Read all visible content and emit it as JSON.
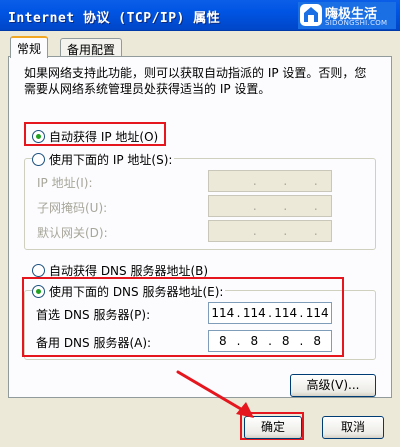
{
  "window": {
    "title": "Internet 协议 (TCP/IP) 属性"
  },
  "watermark": {
    "name": "嗨极生活",
    "url": "SIDONGSHI.COM"
  },
  "tabs": [
    {
      "label": "常规",
      "active": true
    },
    {
      "label": "备用配置",
      "active": false
    }
  ],
  "description": "如果网络支持此功能，则可以获取自动指派的 IP 设置。否则，您需要从网络系统管理员处获得适当的 IP 设置。",
  "ip": {
    "auto_label": "自动获得 IP 地址(O)",
    "auto_selected": true,
    "manual_label": "使用下面的 IP 地址(S):",
    "manual_selected": false,
    "fields": [
      {
        "label": "IP 地址(I):",
        "value": [
          ".",
          ".",
          "."
        ]
      },
      {
        "label": "子网掩码(U):",
        "value": [
          ".",
          ".",
          "."
        ]
      },
      {
        "label": "默认网关(D):",
        "value": [
          ".",
          ".",
          "."
        ]
      }
    ]
  },
  "dns": {
    "auto_label": "自动获得 DNS 服务器地址(B)",
    "auto_selected": false,
    "manual_label": "使用下面的 DNS 服务器地址(E):",
    "manual_selected": true,
    "preferred_label": "首选 DNS 服务器(P):",
    "preferred_value": [
      "114",
      "114",
      "114",
      "114"
    ],
    "alternate_label": "备用 DNS 服务器(A):",
    "alternate_value": [
      "8",
      "8",
      "8",
      "8"
    ]
  },
  "buttons": {
    "advanced": "高级(V)...",
    "ok": "确定",
    "cancel": "取消"
  },
  "colors": {
    "titlebar": "#0054e3",
    "dialog_bg": "#ece9d8",
    "highlight": "#e5161e",
    "radio_dot": "#21a121"
  }
}
